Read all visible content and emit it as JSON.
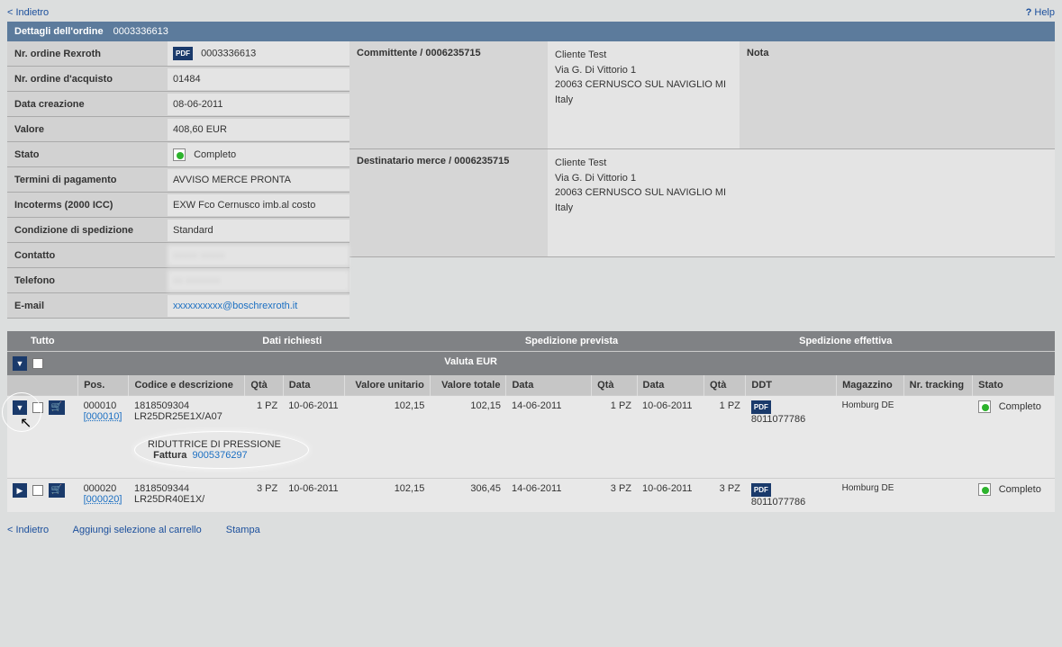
{
  "topBar": {
    "back": "< Indietro",
    "help": "Help"
  },
  "header": {
    "title": "Dettagli dell'ordine",
    "orderNum": "0003336613"
  },
  "details": {
    "nrRexroth": {
      "label": "Nr. ordine Rexroth",
      "value": "0003336613"
    },
    "nrAcquisto": {
      "label": "Nr. ordine d'acquisto",
      "value": "01484"
    },
    "dataCreazione": {
      "label": "Data creazione",
      "value": "08-06-2011"
    },
    "valore": {
      "label": "Valore",
      "value": "408,60  EUR"
    },
    "stato": {
      "label": "Stato",
      "value": "Completo"
    },
    "termini": {
      "label": "Termini di pagamento",
      "value": "AVVISO MERCE PRONTA"
    },
    "incoterms": {
      "label": "Incoterms (2000 ICC)",
      "value": "EXW Fco Cernusco imb.al costo"
    },
    "condSped": {
      "label": "Condizione di spedizione",
      "value": "Standard"
    },
    "contatto": {
      "label": "Contatto",
      "value": "xxxxx xxxxx"
    },
    "telefono": {
      "label": "Telefono",
      "value": "xx xxxxxxx"
    },
    "email": {
      "label": "E-mail",
      "value": "xxxxxxxxxx@boschrexroth.it"
    }
  },
  "committente": {
    "label": "Committente / 0006235715",
    "name": "Cliente Test",
    "addr1": "Via G. Di Vittorio 1",
    "addr2": "20063 CERNUSCO SUL NAVIGLIO MI",
    "addr3": "Italy"
  },
  "destinatario": {
    "label": "Destinatario merce / 0006235715",
    "name": "Cliente Test",
    "addr1": "Via G. Di Vittorio 1",
    "addr2": "20063 CERNUSCO SUL NAVIGLIO MI",
    "addr3": "Italy"
  },
  "nota": {
    "label": "Nota"
  },
  "table": {
    "groups": {
      "tutto": "Tutto",
      "dati": "Dati richiesti",
      "spedPrev": "Spedizione prevista",
      "spedEff": "Spedizione effettiva"
    },
    "currency": "Valuta EUR",
    "cols": {
      "pos": "Pos.",
      "codice": "Codice e descrizione",
      "qta": "Qtà",
      "data": "Data",
      "valUnit": "Valore unitario",
      "valTot": "Valore totale",
      "dataPrev": "Data",
      "qtaPrev": "Qtà",
      "dataEff": "Data",
      "qtaEff": "Qtà",
      "ddt": "DDT",
      "magazzino": "Magazzino",
      "tracking": "Nr. tracking",
      "stato": "Stato"
    },
    "rows": [
      {
        "pos": "000010",
        "posSub": "[000010]",
        "code": "1818509304",
        "desc": "LR25DR25E1X/A07",
        "qta": "1  PZ",
        "data": "10-06-2011",
        "valUnit": "102,15",
        "valTot": "102,15",
        "dataPrev": "14-06-2011",
        "qtaPrev": "1  PZ",
        "dataEff": "10-06-2011",
        "qtaEff": "1  PZ",
        "ddt": "8011077786",
        "magazzino": "Homburg DE",
        "tracking": "",
        "stato": "Completo",
        "expanded": true,
        "detailDesc": "RIDUTTRICE DI PRESSIONE",
        "fatturaLabel": "Fattura",
        "fatturaNum": "9005376297"
      },
      {
        "pos": "000020",
        "posSub": "[000020]",
        "code": "1818509344",
        "desc": "LR25DR40E1X/",
        "qta": "3  PZ",
        "data": "10-06-2011",
        "valUnit": "102,15",
        "valTot": "306,45",
        "dataPrev": "14-06-2011",
        "qtaPrev": "3  PZ",
        "dataEff": "10-06-2011",
        "qtaEff": "3  PZ",
        "ddt": "8011077786",
        "magazzino": "Homburg DE",
        "tracking": "",
        "stato": "Completo",
        "expanded": false
      }
    ]
  },
  "bottom": {
    "back": "< Indietro",
    "addCart": "Aggiungi selezione al carrello",
    "print": "Stampa"
  }
}
